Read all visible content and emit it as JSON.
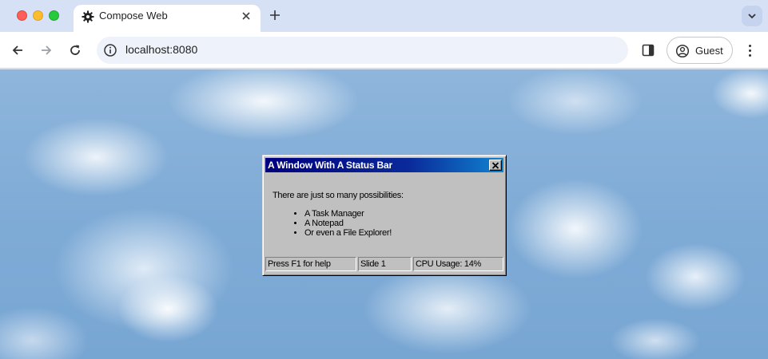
{
  "browser": {
    "tab": {
      "title": "Compose Web",
      "favicon": "gear-icon",
      "close_icon": "close-icon"
    },
    "new_tab_icon": "plus-icon",
    "tab_menu_icon": "chevron-down-icon",
    "nav": {
      "back_icon": "arrow-left-icon",
      "forward_icon": "arrow-right-icon",
      "reload_icon": "reload-icon"
    },
    "address_bar": {
      "url": "localhost:8080",
      "site_info_icon": "info-icon"
    },
    "side_panel_icon": "side-panel-icon",
    "profile": {
      "label": "Guest",
      "icon": "account-circle-icon"
    },
    "menu_icon": "more-vertical-icon"
  },
  "window": {
    "title": "A Window With A Status Bar",
    "close_icon": "close-icon",
    "body": {
      "intro": "There are just so many possibilities:",
      "items": [
        "A Task Manager",
        "A Notepad",
        "Or even a File Explorer!"
      ]
    },
    "statusbar": {
      "help": "Press F1 for help",
      "slide": "Slide 1",
      "cpu": "CPU Usage: 14%"
    }
  },
  "colors": {
    "titlebar_start": "#000080",
    "titlebar_end": "#1084d0",
    "window_face": "#c0c0c0",
    "sky": "#7fabd6"
  }
}
